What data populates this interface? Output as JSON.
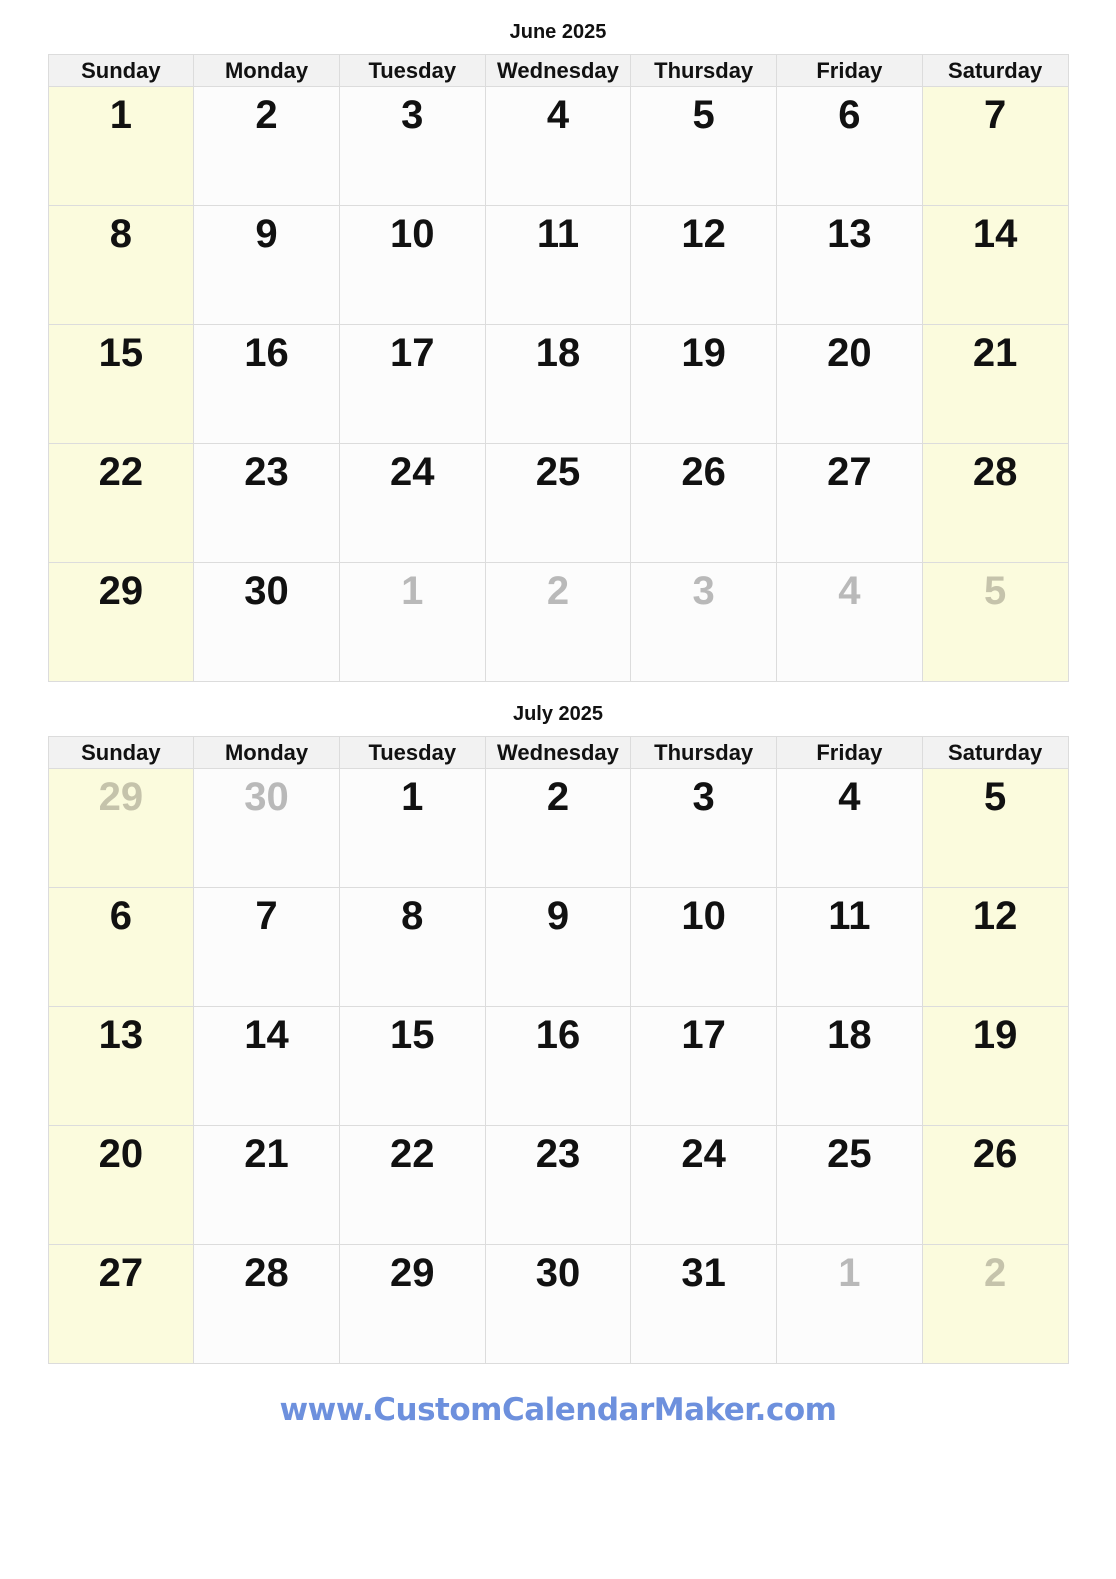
{
  "weekday_headers": [
    "Sunday",
    "Monday",
    "Tuesday",
    "Wednesday",
    "Thursday",
    "Friday",
    "Saturday"
  ],
  "colors": {
    "weekend_background": "#fbfbdd",
    "weekday_background": "#fcfcfc",
    "header_background": "#f2f2f2",
    "grid_border": "#dcdcdc",
    "day_text": "#111111",
    "other_month_text": "#b9b9b9",
    "footer_link": "#6d90dd"
  },
  "months": [
    {
      "title": "June 2025",
      "weeks": [
        [
          {
            "day": "1",
            "other_month": false,
            "weekend": true
          },
          {
            "day": "2",
            "other_month": false,
            "weekend": false
          },
          {
            "day": "3",
            "other_month": false,
            "weekend": false
          },
          {
            "day": "4",
            "other_month": false,
            "weekend": false
          },
          {
            "day": "5",
            "other_month": false,
            "weekend": false
          },
          {
            "day": "6",
            "other_month": false,
            "weekend": false
          },
          {
            "day": "7",
            "other_month": false,
            "weekend": true
          }
        ],
        [
          {
            "day": "8",
            "other_month": false,
            "weekend": true
          },
          {
            "day": "9",
            "other_month": false,
            "weekend": false
          },
          {
            "day": "10",
            "other_month": false,
            "weekend": false
          },
          {
            "day": "11",
            "other_month": false,
            "weekend": false
          },
          {
            "day": "12",
            "other_month": false,
            "weekend": false
          },
          {
            "day": "13",
            "other_month": false,
            "weekend": false
          },
          {
            "day": "14",
            "other_month": false,
            "weekend": true
          }
        ],
        [
          {
            "day": "15",
            "other_month": false,
            "weekend": true
          },
          {
            "day": "16",
            "other_month": false,
            "weekend": false
          },
          {
            "day": "17",
            "other_month": false,
            "weekend": false
          },
          {
            "day": "18",
            "other_month": false,
            "weekend": false
          },
          {
            "day": "19",
            "other_month": false,
            "weekend": false
          },
          {
            "day": "20",
            "other_month": false,
            "weekend": false
          },
          {
            "day": "21",
            "other_month": false,
            "weekend": true
          }
        ],
        [
          {
            "day": "22",
            "other_month": false,
            "weekend": true
          },
          {
            "day": "23",
            "other_month": false,
            "weekend": false
          },
          {
            "day": "24",
            "other_month": false,
            "weekend": false
          },
          {
            "day": "25",
            "other_month": false,
            "weekend": false
          },
          {
            "day": "26",
            "other_month": false,
            "weekend": false
          },
          {
            "day": "27",
            "other_month": false,
            "weekend": false
          },
          {
            "day": "28",
            "other_month": false,
            "weekend": true
          }
        ],
        [
          {
            "day": "29",
            "other_month": false,
            "weekend": true
          },
          {
            "day": "30",
            "other_month": false,
            "weekend": false
          },
          {
            "day": "1",
            "other_month": true,
            "weekend": false
          },
          {
            "day": "2",
            "other_month": true,
            "weekend": false
          },
          {
            "day": "3",
            "other_month": true,
            "weekend": false
          },
          {
            "day": "4",
            "other_month": true,
            "weekend": false
          },
          {
            "day": "5",
            "other_month": true,
            "weekend": true
          }
        ]
      ]
    },
    {
      "title": "July 2025",
      "weeks": [
        [
          {
            "day": "29",
            "other_month": true,
            "weekend": true
          },
          {
            "day": "30",
            "other_month": true,
            "weekend": false
          },
          {
            "day": "1",
            "other_month": false,
            "weekend": false
          },
          {
            "day": "2",
            "other_month": false,
            "weekend": false
          },
          {
            "day": "3",
            "other_month": false,
            "weekend": false
          },
          {
            "day": "4",
            "other_month": false,
            "weekend": false
          },
          {
            "day": "5",
            "other_month": false,
            "weekend": true
          }
        ],
        [
          {
            "day": "6",
            "other_month": false,
            "weekend": true
          },
          {
            "day": "7",
            "other_month": false,
            "weekend": false
          },
          {
            "day": "8",
            "other_month": false,
            "weekend": false
          },
          {
            "day": "9",
            "other_month": false,
            "weekend": false
          },
          {
            "day": "10",
            "other_month": false,
            "weekend": false
          },
          {
            "day": "11",
            "other_month": false,
            "weekend": false
          },
          {
            "day": "12",
            "other_month": false,
            "weekend": true
          }
        ],
        [
          {
            "day": "13",
            "other_month": false,
            "weekend": true
          },
          {
            "day": "14",
            "other_month": false,
            "weekend": false
          },
          {
            "day": "15",
            "other_month": false,
            "weekend": false
          },
          {
            "day": "16",
            "other_month": false,
            "weekend": false
          },
          {
            "day": "17",
            "other_month": false,
            "weekend": false
          },
          {
            "day": "18",
            "other_month": false,
            "weekend": false
          },
          {
            "day": "19",
            "other_month": false,
            "weekend": true
          }
        ],
        [
          {
            "day": "20",
            "other_month": false,
            "weekend": true
          },
          {
            "day": "21",
            "other_month": false,
            "weekend": false
          },
          {
            "day": "22",
            "other_month": false,
            "weekend": false
          },
          {
            "day": "23",
            "other_month": false,
            "weekend": false
          },
          {
            "day": "24",
            "other_month": false,
            "weekend": false
          },
          {
            "day": "25",
            "other_month": false,
            "weekend": false
          },
          {
            "day": "26",
            "other_month": false,
            "weekend": true
          }
        ],
        [
          {
            "day": "27",
            "other_month": false,
            "weekend": true
          },
          {
            "day": "28",
            "other_month": false,
            "weekend": false
          },
          {
            "day": "29",
            "other_month": false,
            "weekend": false
          },
          {
            "day": "30",
            "other_month": false,
            "weekend": false
          },
          {
            "day": "31",
            "other_month": false,
            "weekend": false
          },
          {
            "day": "1",
            "other_month": true,
            "weekend": false
          },
          {
            "day": "2",
            "other_month": true,
            "weekend": true
          }
        ]
      ]
    }
  ],
  "footer": {
    "url_text": "www.CustomCalendarMaker.com"
  }
}
